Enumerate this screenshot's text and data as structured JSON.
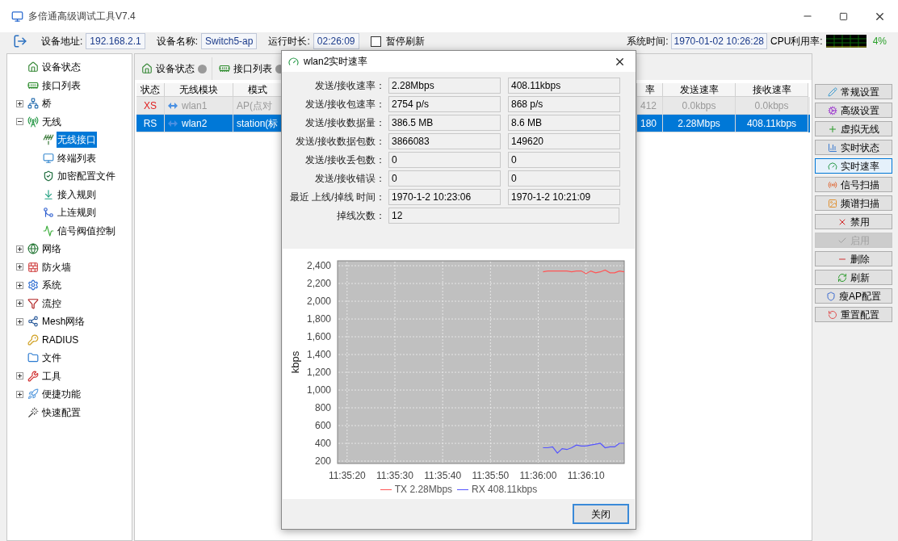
{
  "window": {
    "title": "多倍通高级调试工具V7.4"
  },
  "toolbar": {
    "fields": [
      {
        "label": "设备地址:",
        "value": "192.168.2.1"
      },
      {
        "label": "设备名称:",
        "value": "Switch5-ap"
      },
      {
        "label": "运行时长:",
        "value": "02:26:09"
      }
    ],
    "pause_refresh": {
      "label": "暂停刷新",
      "checked": false
    },
    "system_time": {
      "label": "系统时间:",
      "value": "1970-01-02 10:26:28"
    },
    "cpu": {
      "label": "CPU利用率:",
      "value": "4%"
    }
  },
  "tree": [
    {
      "label": "设备状态",
      "selected": false
    },
    {
      "label": "接口列表",
      "selected": false
    },
    {
      "label": "桥",
      "selected": false,
      "expanded": false
    },
    {
      "label": "无线",
      "selected": false,
      "expanded": true,
      "children": [
        {
          "label": "无线接口",
          "selected": true
        },
        {
          "label": "终端列表",
          "selected": false
        },
        {
          "label": "加密配置文件",
          "selected": false
        },
        {
          "label": "接入规则",
          "selected": false
        },
        {
          "label": "上连规则",
          "selected": false
        },
        {
          "label": "信号阀值控制",
          "selected": false
        }
      ]
    },
    {
      "label": "网络",
      "selected": false,
      "expanded": false
    },
    {
      "label": "防火墙",
      "selected": false,
      "expanded": false
    },
    {
      "label": "系统",
      "selected": false,
      "expanded": false
    },
    {
      "label": "流控",
      "selected": false,
      "expanded": false
    },
    {
      "label": "Mesh网络",
      "selected": false,
      "expanded": false
    },
    {
      "label": "RADIUS",
      "selected": false
    },
    {
      "label": "文件",
      "selected": false
    },
    {
      "label": "工具",
      "selected": false,
      "expanded": false
    },
    {
      "label": "便捷功能",
      "selected": false,
      "expanded": false
    },
    {
      "label": "快速配置",
      "selected": false
    }
  ],
  "tabs": [
    {
      "label": "设备状态"
    },
    {
      "label": "接口列表"
    }
  ],
  "table": {
    "columns": [
      "状态",
      "无线模块",
      "模式",
      "率",
      "发送速率",
      "接收速率"
    ],
    "rows": [
      {
        "cells": [
          "XS",
          "wlan1",
          "AP(点对",
          "412",
          "0.0kbps",
          "0.0kbps"
        ],
        "selected": false,
        "disabled": true
      },
      {
        "cells": [
          "RS",
          "wlan2",
          "station(标",
          "180",
          "2.28Mbps",
          "408.11kbps"
        ],
        "selected": true,
        "disabled": false
      }
    ]
  },
  "actions": [
    {
      "label": "常规设置",
      "selected": false,
      "disabled": false
    },
    {
      "label": "高级设置",
      "selected": false,
      "disabled": false
    },
    {
      "label": "虚拟无线",
      "selected": false,
      "disabled": false
    },
    {
      "label": "实时状态",
      "selected": false,
      "disabled": false
    },
    {
      "label": "实时速率",
      "selected": true,
      "disabled": false
    },
    {
      "label": "信号扫描",
      "selected": false,
      "disabled": false
    },
    {
      "label": "频谱扫描",
      "selected": false,
      "disabled": false
    },
    {
      "label": "禁用",
      "selected": false,
      "disabled": false
    },
    {
      "label": "启用",
      "selected": false,
      "disabled": true
    },
    {
      "label": "删除",
      "selected": false,
      "disabled": false
    },
    {
      "label": "刷新",
      "selected": false,
      "disabled": false
    },
    {
      "label": "瘦AP配置",
      "selected": false,
      "disabled": false
    },
    {
      "label": "重置配置",
      "selected": false,
      "disabled": false
    }
  ],
  "dialog": {
    "title": "wlan2实时速率",
    "rows": [
      {
        "label": "发送/接收速率：",
        "values": [
          "2.28Mbps",
          "408.11kbps"
        ]
      },
      {
        "label": "发送/接收包速率：",
        "values": [
          "2754 p/s",
          "868 p/s"
        ]
      },
      {
        "label": "发送/接收数据量：",
        "values": [
          "386.5 MB",
          "8.6 MB"
        ]
      },
      {
        "label": "发送/接收数据包数：",
        "values": [
          "3866083",
          "149620"
        ]
      },
      {
        "label": "发送/接收丢包数：",
        "values": [
          "0",
          "0"
        ]
      },
      {
        "label": "发送/接收错误：",
        "values": [
          "0",
          "0"
        ]
      },
      {
        "label": "最近 上线/掉线 时间：",
        "values": [
          "1970-1-2 10:23:06",
          "1970-1-2 10:21:09"
        ]
      },
      {
        "label": "掉线次数：",
        "values": [
          "12"
        ]
      }
    ],
    "chart_data": {
      "type": "line",
      "ylabel": "kbps",
      "grid": true,
      "legend": "bottom",
      "x": [
        41761,
        41762,
        41763,
        41764,
        41765,
        41766,
        41767,
        41768,
        41769,
        41770,
        41771,
        41772,
        41773,
        41774,
        41775,
        41776,
        41777,
        41778
      ],
      "xlim": [
        41718,
        41778
      ],
      "ylim": [
        173,
        2455
      ],
      "xticks": [
        {
          "value": 41720,
          "label": "11:35:20"
        },
        {
          "value": 41730,
          "label": "11:35:30"
        },
        {
          "value": 41740,
          "label": "11:35:40"
        },
        {
          "value": 41750,
          "label": "11:35:50"
        },
        {
          "value": 41760,
          "label": "11:36:00"
        },
        {
          "value": 41770,
          "label": "11:36:10"
        }
      ],
      "yticks": [
        {
          "value": 200,
          "label": "200"
        },
        {
          "value": 400,
          "label": "400"
        },
        {
          "value": 600,
          "label": "600"
        },
        {
          "value": 800,
          "label": "800"
        },
        {
          "value": 1000,
          "label": "1,000"
        },
        {
          "value": 1200,
          "label": "1,200"
        },
        {
          "value": 1400,
          "label": "1,400"
        },
        {
          "value": 1600,
          "label": "1,600"
        },
        {
          "value": 1800,
          "label": "1,800"
        },
        {
          "value": 2000,
          "label": "2,000"
        },
        {
          "value": 2200,
          "label": "2,200"
        },
        {
          "value": 2400,
          "label": "2,400"
        }
      ],
      "series": [
        {
          "name": "TX 2.28Mbps",
          "color": "#ff5555",
          "values": [
            2330,
            2340,
            2340,
            2340,
            2340,
            2340,
            2330,
            2340,
            2340,
            2310,
            2340,
            2320,
            2330,
            2350,
            2320,
            2320,
            2340,
            2330
          ]
        },
        {
          "name": "RX 408.11kbps",
          "color": "#5555ff",
          "values": [
            350,
            350,
            360,
            290,
            340,
            330,
            350,
            380,
            370,
            370,
            380,
            390,
            400,
            350,
            360,
            360,
            400,
            400
          ]
        }
      ]
    },
    "close_button": "关闭"
  }
}
